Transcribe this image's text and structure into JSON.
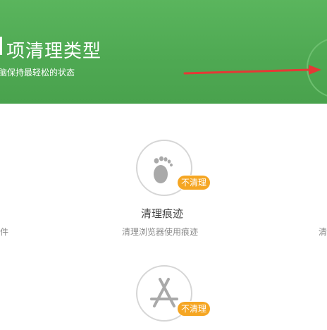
{
  "header": {
    "title": "项清理类型",
    "subtitle": "脑保持最轻松的状态",
    "arrow_color": "#e53935",
    "banner_color": "#4fa953"
  },
  "items": [
    {
      "icon": "footprint-icon",
      "title": "清理痕迹",
      "description": "清理浏览器使用痕迹",
      "badge": "不清理"
    },
    {
      "icon": "app-store-icon",
      "badge": "不清理"
    }
  ],
  "partial_left": {
    "badge_fragment": "",
    "desc_fragment": "件"
  },
  "partial_right": {
    "desc_fragment": "清"
  },
  "colors": {
    "badge": "#f5a623",
    "icon_gray": "#a9a9a9",
    "circle_border": "#d6d6d6"
  }
}
